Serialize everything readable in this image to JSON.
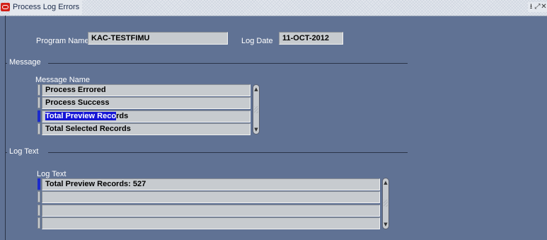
{
  "window": {
    "title": "Process Log Errors",
    "buttons": {
      "minimize": "⭳",
      "maximize": "⤢",
      "close": "✕"
    }
  },
  "header": {
    "program_name_label": "Program Name",
    "program_name_value": "KAC-TESTFIMU",
    "log_date_label": "Log Date",
    "log_date_value": "11-OCT-2012"
  },
  "message_section": {
    "title": "Message",
    "column_label": "Message Name",
    "rows": [
      {
        "text": "Process Errored"
      },
      {
        "text": "Process Success"
      },
      {
        "text_selected": "Total Preview Reco",
        "text_rest": "rds"
      },
      {
        "text": "Total Selected Records"
      }
    ]
  },
  "log_section": {
    "title": "Log Text",
    "column_label": "Log Text",
    "rows": [
      {
        "text": "Total Preview Records: 527"
      },
      {
        "text": ""
      },
      {
        "text": ""
      },
      {
        "text": ""
      }
    ]
  },
  "icons": {
    "scroll_up": "▲",
    "scroll_down": "▼"
  },
  "colors": {
    "background": "#607294",
    "field": "#c7cbcf",
    "selection": "#1515d6",
    "current_record": "#1b2acc"
  }
}
